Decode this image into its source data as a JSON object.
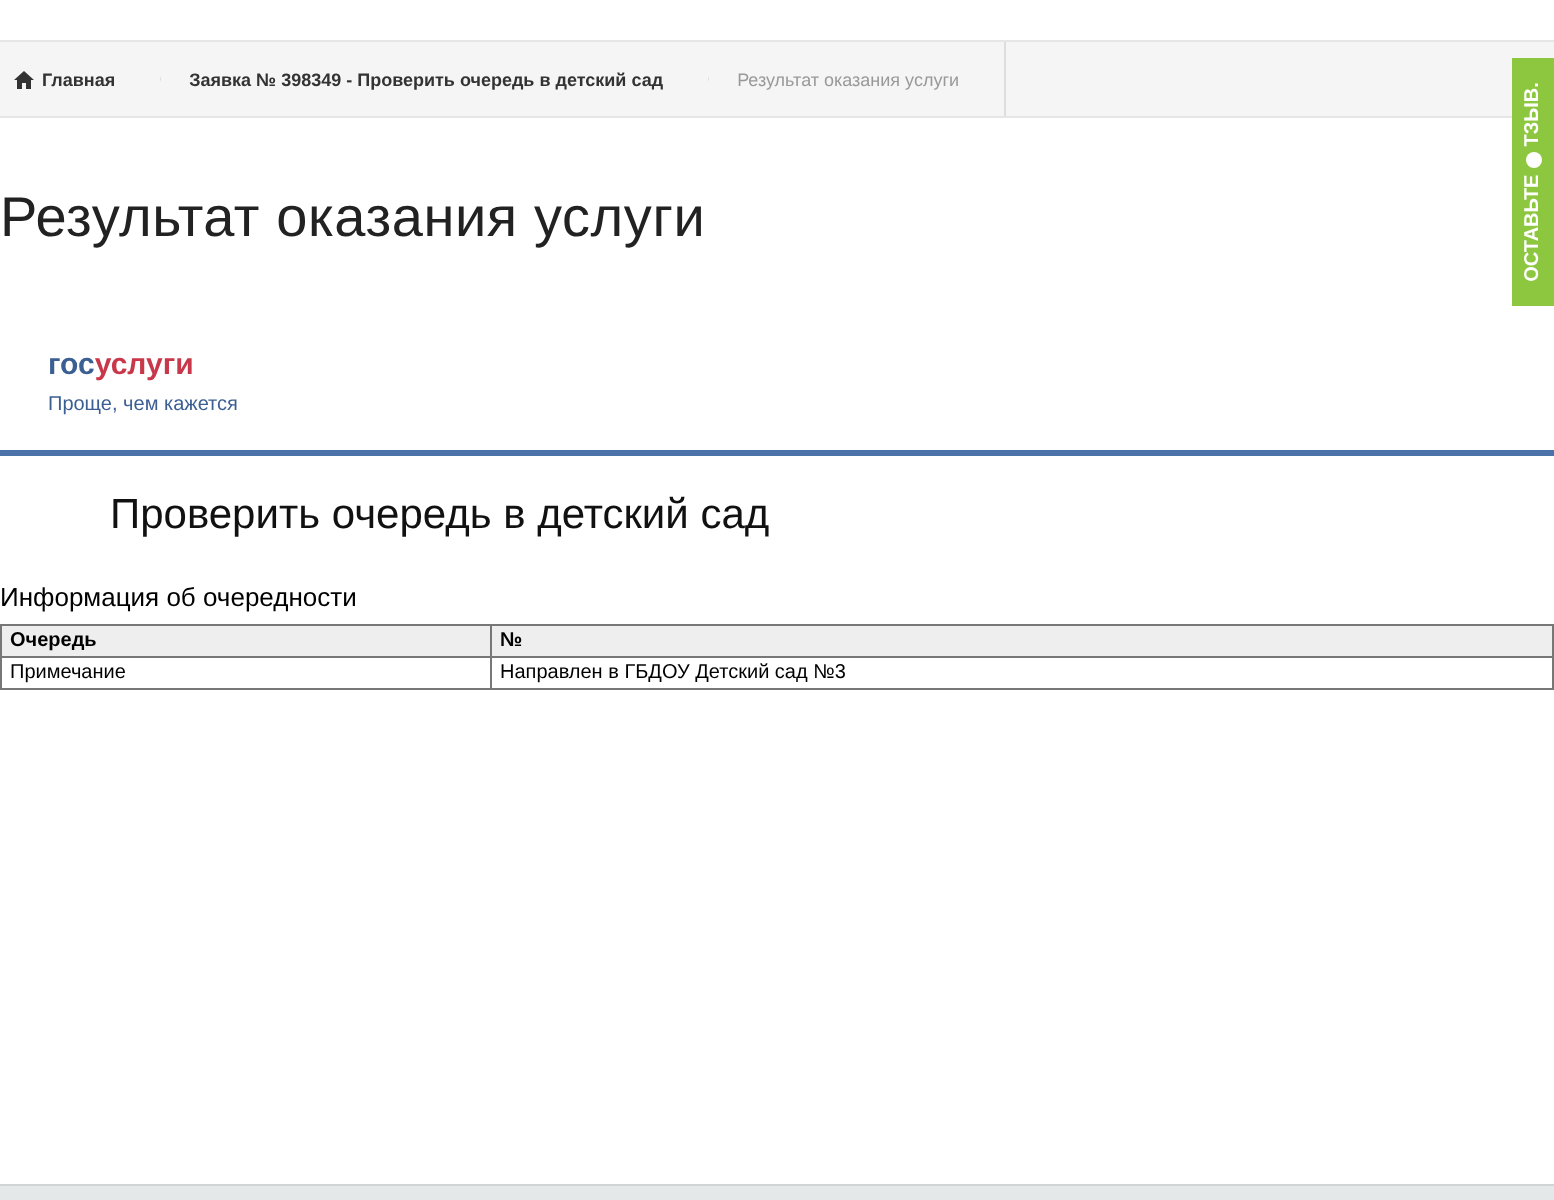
{
  "breadcrumbs": [
    {
      "label": "Главная",
      "kind": "home"
    },
    {
      "label": "Заявка № 398349 - Проверить очередь в детский сад",
      "kind": "link"
    },
    {
      "label": "Результат оказания услуги",
      "kind": "current"
    }
  ],
  "feedback_tab": {
    "before": "ОСТАВЬТЕ",
    "after": "ТЗЫВ."
  },
  "page_title": "Результат оказания услуги",
  "logo": {
    "part_1": "гос",
    "part_2": "услуги",
    "tagline": "Проще, чем кажется"
  },
  "service_title": "Проверить очередь в детский сад",
  "section_title": "Информация об очередности",
  "table": {
    "columns": [
      "Очередь",
      "№"
    ],
    "rows": [
      [
        "Примечание",
        "Направлен в ГБДОУ Детский сад №3"
      ]
    ]
  }
}
